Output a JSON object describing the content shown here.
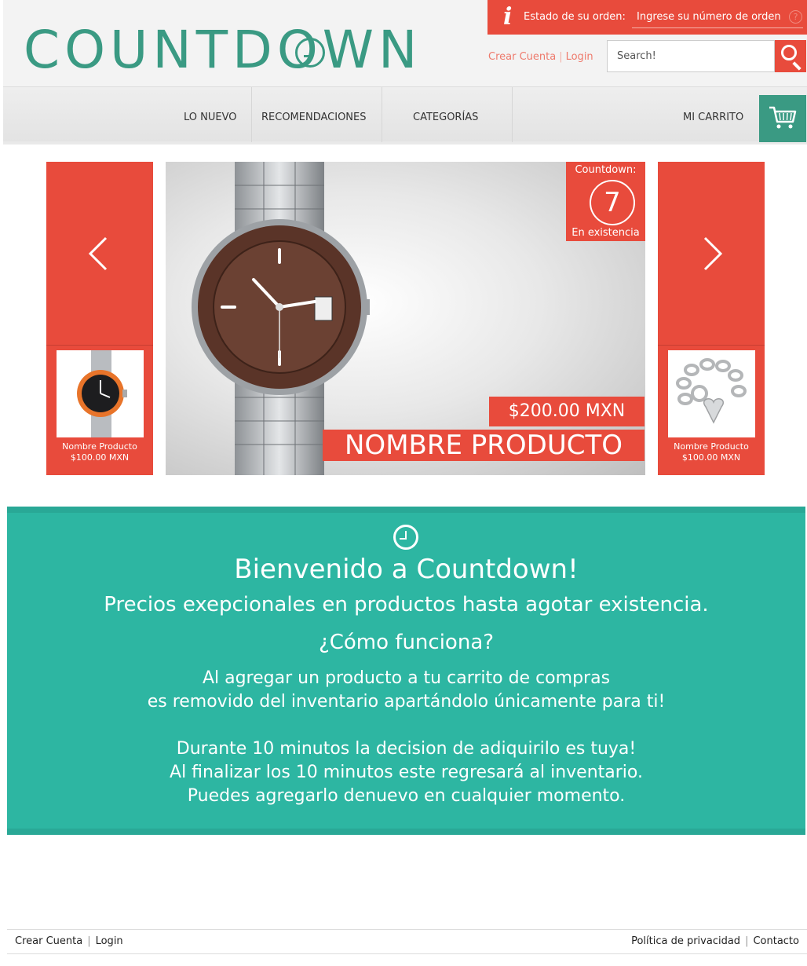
{
  "header": {
    "logo": "COUNTDOWN",
    "order_status_label": "Estado de su orden:",
    "order_input_placeholder": "Ingrese su número de orden",
    "order_help": "?",
    "create_account": "Crear Cuenta",
    "login": "Login",
    "search_placeholder": "Search!"
  },
  "nav": {
    "items": [
      {
        "label": "LO NUEVO"
      },
      {
        "label": "RECOMENDACIONES"
      },
      {
        "label": "CATEGORÍAS"
      }
    ],
    "cart_label": "MI CARRITO"
  },
  "slider": {
    "prev_item": {
      "name": "Nombre Producto",
      "price": "$100.00 MXN",
      "image": "orange-watch"
    },
    "next_item": {
      "name": "Nombre Producto",
      "price": "$100.00 MXN",
      "image": "silver-bracelet"
    },
    "main": {
      "countdown_label": "Countdown:",
      "countdown_value": "7",
      "stock_label": "En existencia",
      "price": "$200.00 MXN",
      "name": "NOMBRE PRODUCTO"
    }
  },
  "welcome": {
    "title": "Bienvenido a Countdown!",
    "subtitle": "Precios exepcionales en productos hasta agotar existencia.",
    "question": "¿Cómo funciona?",
    "lines": [
      "Al agregar un producto a tu carrito de compras",
      "es removido del inventario apartándolo únicamente para ti!",
      "Durante 10 minutos la decision de adiquirilo es tuya!",
      "Al finalizar los 10 minutos este regresará al inventario.",
      "Puedes agregarlo denuevo en cualquier momento."
    ]
  },
  "footer": {
    "create_account": "Crear Cuenta",
    "login": "Login",
    "privacy": "Política de privacidad",
    "contact": "Contacto"
  },
  "colors": {
    "brand_green": "#3a9a83",
    "accent_red": "#e84b3c",
    "band_teal": "#2db6a2"
  },
  "icons": [
    "info-icon",
    "help-icon",
    "search-icon",
    "cart-icon",
    "chevron-left-icon",
    "chevron-right-icon",
    "clock-icon"
  ]
}
